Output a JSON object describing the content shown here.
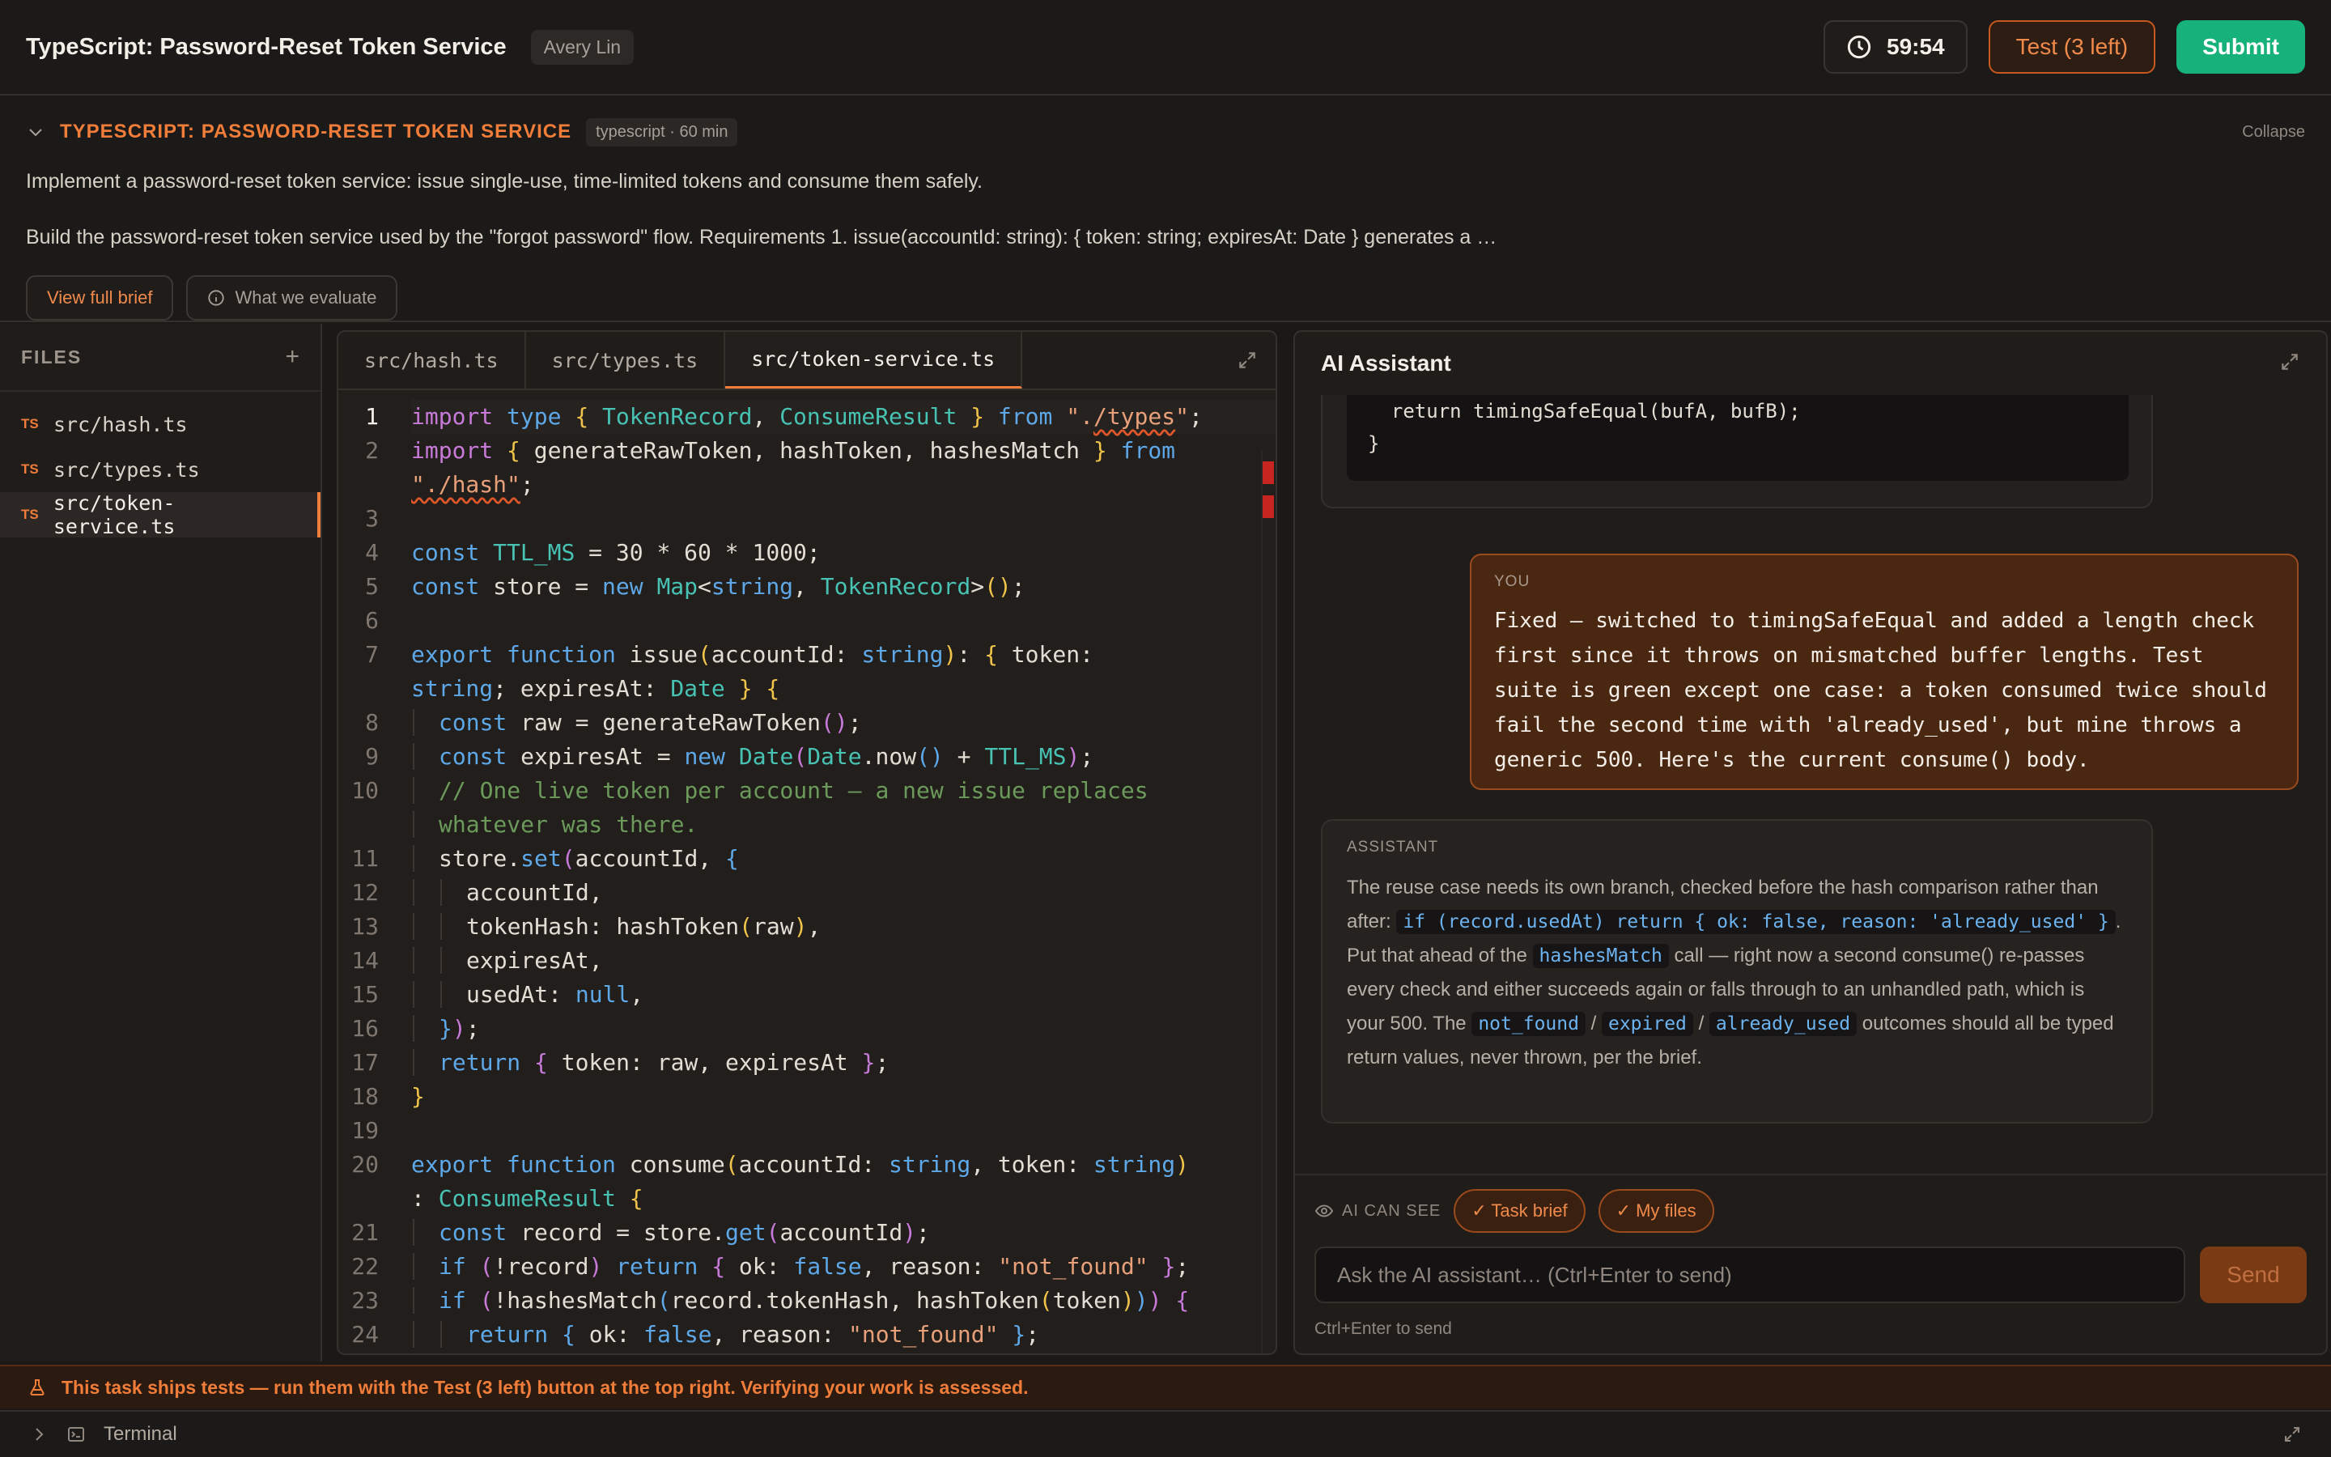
{
  "header": {
    "title": "TypeScript: Password-Reset Token Service",
    "user": "Avery Lin",
    "timer": "59:54",
    "test_button": "Test (3 left)",
    "submit_button": "Submit"
  },
  "brief": {
    "title": "TYPESCRIPT: PASSWORD-RESET TOKEN SERVICE",
    "tag": "typescript · 60 min",
    "collapse": "Collapse",
    "summary": "Implement a password-reset token service: issue single-use, time-limited tokens and consume them safely.",
    "description": "Build the password-reset token service used by the \"forgot password\" flow. Requirements 1. issue(accountId: string): { token: string; expiresAt: Date } generates a …",
    "view_full_brief": "View full brief",
    "what_we_evaluate": "What we evaluate"
  },
  "files": {
    "title": "FILES",
    "add": "+",
    "badge": "TS",
    "items": [
      {
        "name": "src/hash.ts"
      },
      {
        "name": "src/types.ts"
      },
      {
        "name": "src/token-service.ts"
      }
    ]
  },
  "editor": {
    "tabs": [
      "src/hash.ts",
      "src/types.ts",
      "src/token-service.ts"
    ],
    "active_tab": "src/token-service.ts",
    "line_numbers": [
      "1",
      "2",
      "",
      "3",
      "4",
      "5",
      "6",
      "7",
      "",
      "8",
      "9",
      "10",
      "",
      "11",
      "12",
      "13",
      "14",
      "15",
      "16",
      "17",
      "18",
      "19",
      "20",
      "",
      "21",
      "22",
      "23",
      "24"
    ]
  },
  "ai": {
    "title": "AI Assistant",
    "prev_code_line1": "  return timingSafeEqual(bufA, bufB);",
    "prev_code_line2": "}",
    "you_label": "YOU",
    "you_text": "Fixed — switched to timingSafeEqual and added a length check first since it throws on mismatched buffer lengths. Test suite is green except one case: a token consumed twice should fail the second time with 'already_used', but mine throws a generic 500. Here's the current consume() body.",
    "assistant_label": "ASSISTANT",
    "assistant_p1": "The reuse case needs its own branch, checked before the hash comparison rather than after: ",
    "assistant_code1": "if (record.usedAt) return { ok: false, reason: 'already_used' }",
    "assistant_p2": ". Put that ahead of the ",
    "assistant_code2": "hashesMatch",
    "assistant_p3": " call — right now a second consume() re-passes every check and either succeeds again or falls through to an unhandled path, which is your 500. The ",
    "assistant_code3": "not_found",
    "assistant_sep1": " / ",
    "assistant_code4": "expired",
    "assistant_sep2": " / ",
    "assistant_code5": "already_used",
    "assistant_p4": " outcomes should all be typed return values, never thrown, per the brief.",
    "can_see_label": "AI CAN SEE",
    "chip_task": "✓ Task brief",
    "chip_files": "✓ My files",
    "input_placeholder": "Ask the AI assistant… (Ctrl+Enter to send)",
    "send_button": "Send",
    "send_hint": "Ctrl+Enter to send"
  },
  "notice": "This task ships tests — run them with the Test (3 left) button at the top right. Verifying your work is assessed.",
  "terminal": "Terminal",
  "colors": {
    "accent": "#f07d3a",
    "submit": "#16b27a",
    "background": "#1b1917"
  }
}
